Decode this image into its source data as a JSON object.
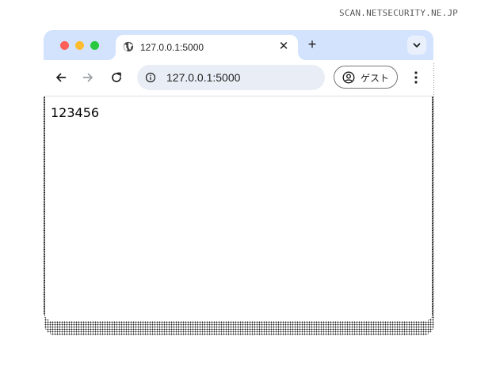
{
  "watermark": "SCAN.NETSECURITY.NE.JP",
  "browser": {
    "tab": {
      "title": "127.0.0.1:5000",
      "close_glyph": "✕",
      "favicon": "globe-icon"
    },
    "new_tab_glyph": "+",
    "tab_search_icon": "chevron-down-icon",
    "toolbar": {
      "back_icon": "arrow-left-icon",
      "forward_icon": "arrow-right-icon",
      "reload_icon": "reload-icon",
      "omnibox": {
        "info_icon": "info-icon",
        "url": "127.0.0.1:5000"
      },
      "profile": {
        "icon": "account-circle-icon",
        "label": "ゲスト"
      },
      "menu_icon": "more-vertical-icon"
    },
    "colors": {
      "tabstrip": "#d3e3fd",
      "omnibox": "#e9eef6",
      "close_red": "#ff5f57",
      "minimize_yellow": "#febc2e",
      "zoom_green": "#28c840"
    }
  },
  "page": {
    "text": "123456"
  }
}
